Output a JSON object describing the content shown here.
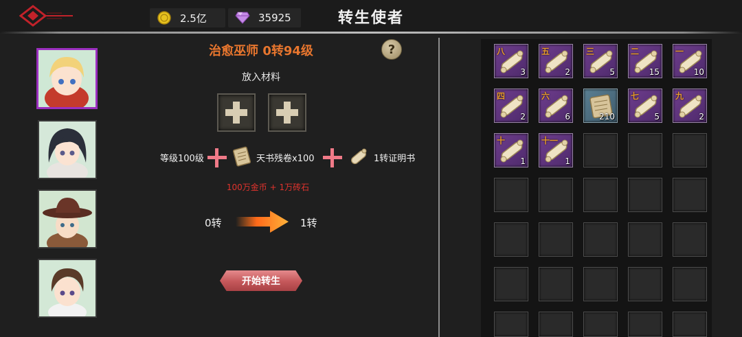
{
  "header": {
    "title": "转生使者",
    "gold": "2.5亿",
    "gems": "35925"
  },
  "left": {
    "character_name": "治愈巫师 0转94级",
    "help_label": "?",
    "put_label": "放入材料",
    "requirements": {
      "level": "等级100级",
      "scroll": "天书残卷x100",
      "cert": "1转证明书"
    },
    "cost": "100万金币 + 1万砖石",
    "from_turn": "0转",
    "to_turn": "1转",
    "start_button": "开始转生"
  },
  "inventory": [
    {
      "tag": "八",
      "count": "3",
      "type": "scroll"
    },
    {
      "tag": "五",
      "count": "2",
      "type": "scroll"
    },
    {
      "tag": "三",
      "count": "5",
      "type": "scroll"
    },
    {
      "tag": "二",
      "count": "15",
      "type": "scroll"
    },
    {
      "tag": "一",
      "count": "10",
      "type": "scroll"
    },
    {
      "tag": "四",
      "count": "2",
      "type": "scroll"
    },
    {
      "tag": "六",
      "count": "6",
      "type": "scroll"
    },
    {
      "tag": "",
      "count": "210",
      "type": "parchment"
    },
    {
      "tag": "七",
      "count": "5",
      "type": "scroll"
    },
    {
      "tag": "九",
      "count": "2",
      "type": "scroll"
    },
    {
      "tag": "十",
      "count": "1",
      "type": "scroll"
    },
    {
      "tag": "十一",
      "count": "1",
      "type": "scroll"
    }
  ],
  "colors": {
    "accent_orange": "#e8762e",
    "cost_red": "#e0332d",
    "selected_border": "#9b2fbf",
    "item_purple": "#6e3d8d"
  }
}
